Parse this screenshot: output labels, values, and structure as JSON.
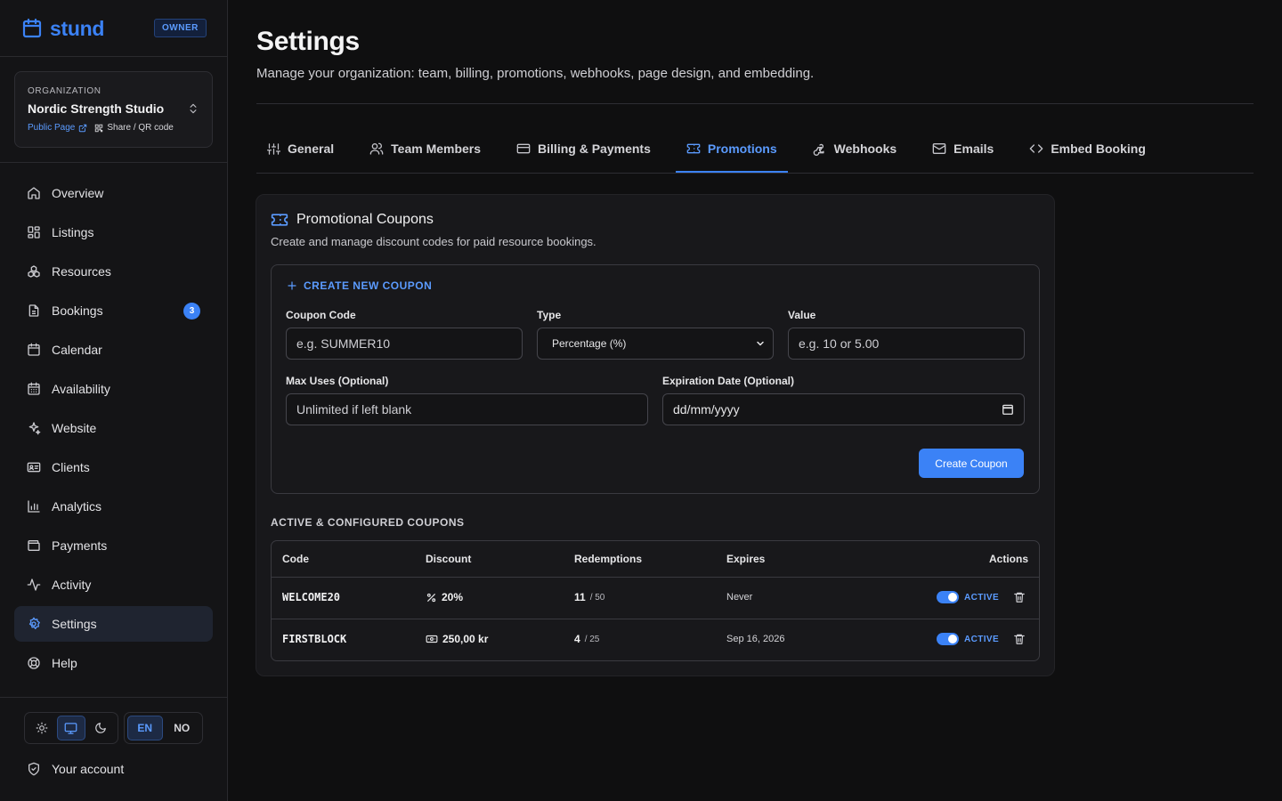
{
  "brand": {
    "name": "stund",
    "role_badge": "OWNER"
  },
  "organization": {
    "label": "ORGANIZATION",
    "name": "Nordic Strength Studio",
    "public_page": "Public Page",
    "share": "Share / QR code"
  },
  "nav": [
    {
      "label": "Overview",
      "icon": "home-icon"
    },
    {
      "label": "Listings",
      "icon": "grid-icon"
    },
    {
      "label": "Resources",
      "icon": "boxes-icon"
    },
    {
      "label": "Bookings",
      "icon": "file-icon",
      "badge": "3"
    },
    {
      "label": "Calendar",
      "icon": "calendar-icon"
    },
    {
      "label": "Availability",
      "icon": "calendar-days-icon"
    },
    {
      "label": "Website",
      "icon": "sparkles-icon"
    },
    {
      "label": "Clients",
      "icon": "id-card-icon"
    },
    {
      "label": "Analytics",
      "icon": "bar-chart-icon"
    },
    {
      "label": "Payments",
      "icon": "wallet-icon"
    },
    {
      "label": "Activity",
      "icon": "activity-icon"
    },
    {
      "label": "Settings",
      "icon": "gear-icon",
      "active": true
    },
    {
      "label": "Help",
      "icon": "lifebuoy-icon"
    }
  ],
  "theme": {
    "active": "system",
    "options": [
      "light",
      "system",
      "dark"
    ]
  },
  "language": {
    "options": [
      "EN",
      "NO"
    ],
    "active": "EN"
  },
  "account": {
    "label": "Your account"
  },
  "page": {
    "title": "Settings",
    "subtitle": "Manage your organization: team, billing, promotions, webhooks, page design, and embedding."
  },
  "tabs": [
    {
      "label": "General",
      "icon": "sliders-icon"
    },
    {
      "label": "Team Members",
      "icon": "users-icon"
    },
    {
      "label": "Billing & Payments",
      "icon": "credit-card-icon"
    },
    {
      "label": "Promotions",
      "icon": "ticket-icon",
      "active": true
    },
    {
      "label": "Webhooks",
      "icon": "webhook-icon"
    },
    {
      "label": "Emails",
      "icon": "mail-icon"
    },
    {
      "label": "Embed Booking",
      "icon": "code-icon"
    }
  ],
  "promotions": {
    "title": "Promotional Coupons",
    "description": "Create and manage discount codes for paid resource bookings.",
    "create": {
      "heading": "CREATE NEW COUPON",
      "code_label": "Coupon Code",
      "code_placeholder": "e.g. SUMMER10",
      "type_label": "Type",
      "type_value": "Percentage (%)",
      "value_label": "Value",
      "value_placeholder": "e.g. 10 or 5.00",
      "max_uses_label": "Max Uses (Optional)",
      "max_uses_placeholder": "Unlimited if left blank",
      "expiration_label": "Expiration Date (Optional)",
      "expiration_placeholder": "dd/mm/yyyy",
      "submit": "Create Coupon"
    },
    "list_heading": "ACTIVE & CONFIGURED COUPONS",
    "columns": [
      "Code",
      "Discount",
      "Redemptions",
      "Expires",
      "Actions"
    ],
    "coupons": [
      {
        "code": "WELCOME20",
        "discount": "20%",
        "discount_icon": "percent-icon",
        "redeemed": "11",
        "limit": "/ 50",
        "expires": "Never",
        "status": "ACTIVE"
      },
      {
        "code": "FIRSTBLOCK",
        "discount": "250,00 kr",
        "discount_icon": "banknote-icon",
        "redeemed": "4",
        "limit": "/ 25",
        "expires": "Sep 16, 2026",
        "status": "ACTIVE"
      }
    ]
  },
  "colors": {
    "accent": "#3b82f6",
    "background": "#0f0f10",
    "sidebar": "#141416",
    "card": "#18181b"
  }
}
